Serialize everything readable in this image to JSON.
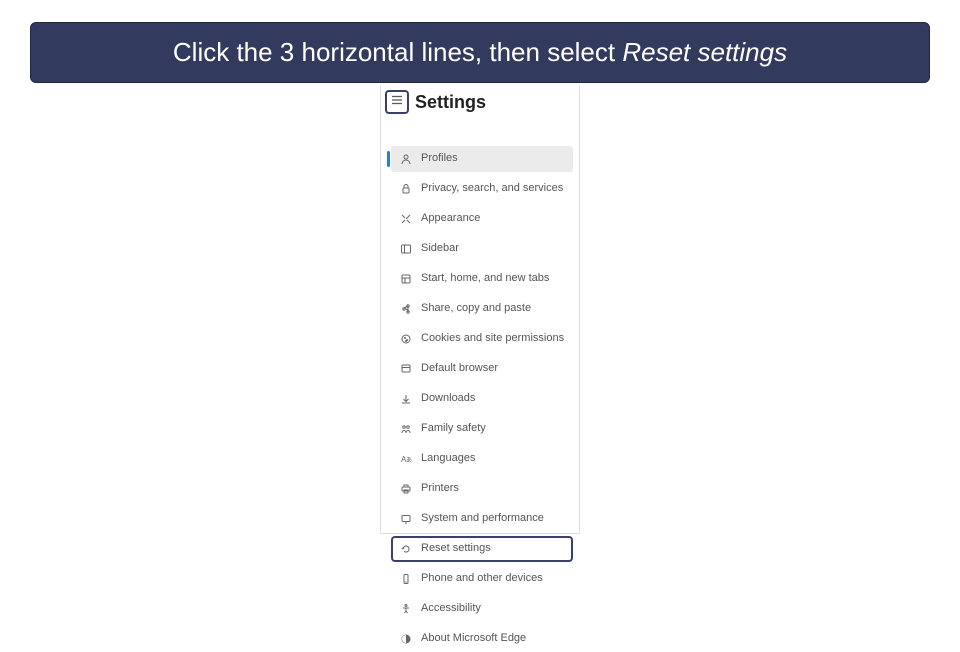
{
  "instruction": {
    "prefix": "Click the 3 horizontal lines, then select ",
    "emphasis": "Reset settings"
  },
  "settings": {
    "title": "Settings",
    "items": [
      {
        "label": "Profiles",
        "icon": "profiles-icon",
        "active": true
      },
      {
        "label": "Privacy, search, and services",
        "icon": "privacy-icon"
      },
      {
        "label": "Appearance",
        "icon": "appearance-icon"
      },
      {
        "label": "Sidebar",
        "icon": "sidebar-icon"
      },
      {
        "label": "Start, home, and new tabs",
        "icon": "start-icon"
      },
      {
        "label": "Share, copy and paste",
        "icon": "share-icon"
      },
      {
        "label": "Cookies and site permissions",
        "icon": "cookies-icon"
      },
      {
        "label": "Default browser",
        "icon": "default-browser-icon"
      },
      {
        "label": "Downloads",
        "icon": "downloads-icon"
      },
      {
        "label": "Family safety",
        "icon": "family-icon"
      },
      {
        "label": "Languages",
        "icon": "languages-icon"
      },
      {
        "label": "Printers",
        "icon": "printers-icon"
      },
      {
        "label": "System and performance",
        "icon": "system-icon"
      },
      {
        "label": "Reset settings",
        "icon": "reset-icon",
        "highlighted": true
      },
      {
        "label": "Phone and other devices",
        "icon": "phone-icon"
      },
      {
        "label": "Accessibility",
        "icon": "accessibility-icon"
      },
      {
        "label": "About Microsoft Edge",
        "icon": "about-icon"
      }
    ]
  }
}
